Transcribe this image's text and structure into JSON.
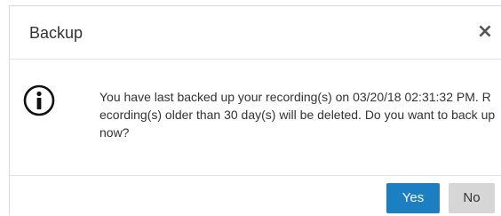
{
  "dialog": {
    "title": "Backup",
    "close_label": "×",
    "icon": "info-icon",
    "message": "You have last backed up your recording(s) on 03/20/18 02:31:32 PM. Recording(s) older than 30 day(s) will be deleted. Do you want to back up now?",
    "buttons": {
      "yes_label": "Yes",
      "no_label": "No"
    }
  },
  "colors": {
    "primary": "#1b7fc2",
    "secondary": "#d6d6d6",
    "text": "#333333"
  }
}
